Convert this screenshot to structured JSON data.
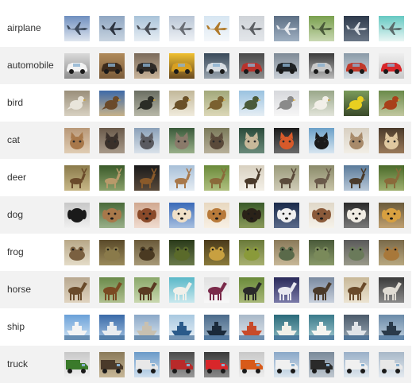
{
  "classes": [
    {
      "label": "airplane",
      "thumbs": [
        {
          "bg": [
            "#6f8fbf",
            "#dfe6ef"
          ],
          "subject": "#3d4a5c",
          "icon": "plane-icon"
        },
        {
          "bg": [
            "#8fa6c2",
            "#c8d4e0"
          ],
          "subject": "#2d3440",
          "icon": "plane-icon"
        },
        {
          "bg": [
            "#a9c3d9",
            "#e8eef4"
          ],
          "subject": "#4a4f57",
          "icon": "plane-icon"
        },
        {
          "bg": [
            "#b9c6d6",
            "#eef1f5"
          ],
          "subject": "#6a6e75",
          "icon": "plane-icon"
        },
        {
          "bg": [
            "#d7e6f2",
            "#f4f7fa"
          ],
          "subject": "#b07a2a",
          "icon": "plane-icon"
        },
        {
          "bg": [
            "#cfd3d8",
            "#e3e6ea"
          ],
          "subject": "#5c5f63",
          "icon": "plane-icon"
        },
        {
          "bg": [
            "#5d6f84",
            "#9fb0c2"
          ],
          "subject": "#e6e9ee",
          "icon": "plane-icon"
        },
        {
          "bg": [
            "#7aa04f",
            "#c9d8b2"
          ],
          "subject": "#4a5a3a",
          "icon": "plane-icon"
        },
        {
          "bg": [
            "#2e3a4c",
            "#6a7686"
          ],
          "subject": "#d9dde3",
          "icon": "plane-icon"
        },
        {
          "bg": [
            "#66c9c2",
            "#e8f6f4"
          ],
          "subject": "#5a6a6a",
          "icon": "plane-icon"
        }
      ]
    },
    {
      "label": "automobile",
      "thumbs": [
        {
          "bg": [
            "#dadada",
            "#8d8d8d"
          ],
          "subject": "#f2f2f2",
          "icon": "car-icon"
        },
        {
          "bg": [
            "#b08a5b",
            "#7b5c3a"
          ],
          "subject": "#3c2a1b",
          "icon": "car-icon"
        },
        {
          "bg": [
            "#7a6a5a",
            "#c9b49a"
          ],
          "subject": "#2f2b28",
          "icon": "car-icon"
        },
        {
          "bg": [
            "#f0c030",
            "#6a4a20"
          ],
          "subject": "#d8a020",
          "icon": "car-icon"
        },
        {
          "bg": [
            "#3a4a5a",
            "#9aa4ae"
          ],
          "subject": "#d7dde3",
          "icon": "car-icon"
        },
        {
          "bg": [
            "#4a4a4a",
            "#8e8e8e"
          ],
          "subject": "#b8322c",
          "icon": "car-icon"
        },
        {
          "bg": [
            "#7e8a96",
            "#c9cfd6"
          ],
          "subject": "#1f2326",
          "icon": "car-icon"
        },
        {
          "bg": [
            "#3b3b3b",
            "#b9b9b9"
          ],
          "subject": "#c8c8c8",
          "icon": "car-icon"
        },
        {
          "bg": [
            "#8a9aa8",
            "#d6dde3"
          ],
          "subject": "#c0392b",
          "icon": "car-icon"
        },
        {
          "bg": [
            "#eeeeee",
            "#c9c9c9"
          ],
          "subject": "#d8262a",
          "icon": "car-icon"
        }
      ]
    },
    {
      "label": "bird",
      "thumbs": [
        {
          "bg": [
            "#9a8f7a",
            "#d8d1c2"
          ],
          "subject": "#e9e5db",
          "icon": "bird-icon"
        },
        {
          "bg": [
            "#3d6aa8",
            "#c7b28a"
          ],
          "subject": "#6a4a2a",
          "icon": "bird-icon"
        },
        {
          "bg": [
            "#6a6e62",
            "#b8b8a8"
          ],
          "subject": "#2a2c26",
          "icon": "bird-icon"
        },
        {
          "bg": [
            "#c2b89a",
            "#f0ebdc"
          ],
          "subject": "#6a5028",
          "icon": "bird-icon"
        },
        {
          "bg": [
            "#a2a87a",
            "#dcd8b8"
          ],
          "subject": "#7a6030",
          "icon": "bird-icon"
        },
        {
          "bg": [
            "#9ac2e0",
            "#e6eef4"
          ],
          "subject": "#4a5a3a",
          "icon": "bird-icon"
        },
        {
          "bg": [
            "#d6d8dc",
            "#f6f6f6"
          ],
          "subject": "#8a8a8a",
          "icon": "bird-icon"
        },
        {
          "bg": [
            "#9aa88a",
            "#e2e4da"
          ],
          "subject": "#f2efe8",
          "icon": "bird-icon"
        },
        {
          "bg": [
            "#7a9a5a",
            "#3a4a2a"
          ],
          "subject": "#e8d020",
          "icon": "bird-icon"
        },
        {
          "bg": [
            "#6a8a4a",
            "#c2c8a0"
          ],
          "subject": "#a8401a",
          "icon": "bird-icon"
        }
      ]
    },
    {
      "label": "cat",
      "thumbs": [
        {
          "bg": [
            "#b89878",
            "#e0cdb4"
          ],
          "subject": "#a8784a",
          "icon": "cat-icon"
        },
        {
          "bg": [
            "#6a5a4a",
            "#a89a8a"
          ],
          "subject": "#3a302a",
          "icon": "cat-icon"
        },
        {
          "bg": [
            "#8aa0b8",
            "#dae2ea"
          ],
          "subject": "#5a5a60",
          "icon": "cat-icon"
        },
        {
          "bg": [
            "#3a5a3a",
            "#9ab08a"
          ],
          "subject": "#8a7a6a",
          "icon": "cat-icon"
        },
        {
          "bg": [
            "#7a7a5a",
            "#b8b09a"
          ],
          "subject": "#5a4a3a",
          "icon": "cat-icon"
        },
        {
          "bg": [
            "#2a4a3a",
            "#6a8a7a"
          ],
          "subject": "#c8b89a",
          "icon": "cat-icon"
        },
        {
          "bg": [
            "#1a1a1a",
            "#6a6a6a"
          ],
          "subject": "#d85a2a",
          "icon": "cat-icon"
        },
        {
          "bg": [
            "#6aa0c8",
            "#d8e6f0"
          ],
          "subject": "#1a1a1a",
          "icon": "cat-icon"
        },
        {
          "bg": [
            "#d8d0c2",
            "#f2eee6"
          ],
          "subject": "#a88a6a",
          "icon": "cat-icon"
        },
        {
          "bg": [
            "#4a3a2a",
            "#9a7a5a"
          ],
          "subject": "#e0c8a0",
          "icon": "cat-icon"
        }
      ]
    },
    {
      "label": "deer",
      "thumbs": [
        {
          "bg": [
            "#8a7a4a",
            "#c8b888"
          ],
          "subject": "#6a4a2a",
          "icon": "deer-icon"
        },
        {
          "bg": [
            "#3a5a2a",
            "#8aa06a"
          ],
          "subject": "#b89a6a",
          "icon": "deer-icon"
        },
        {
          "bg": [
            "#1a1a1a",
            "#5a4a3a"
          ],
          "subject": "#8a5a2a",
          "icon": "deer-icon"
        },
        {
          "bg": [
            "#a8c0d8",
            "#e6edf3"
          ],
          "subject": "#a8784a",
          "icon": "deer-icon"
        },
        {
          "bg": [
            "#6a8a3a",
            "#b0c080"
          ],
          "subject": "#8a6a3a",
          "icon": "deer-icon"
        },
        {
          "bg": [
            "#d8d0c0",
            "#f4f0e8"
          ],
          "subject": "#4a3a2a",
          "icon": "deer-icon"
        },
        {
          "bg": [
            "#9a9a7a",
            "#d0ccb8"
          ],
          "subject": "#5a4a3a",
          "icon": "deer-icon"
        },
        {
          "bg": [
            "#8a8a6a",
            "#c8c4a8"
          ],
          "subject": "#6a5a4a",
          "icon": "deer-icon"
        },
        {
          "bg": [
            "#5a7a9a",
            "#b8c8d8"
          ],
          "subject": "#4a3a2a",
          "icon": "deer-icon"
        },
        {
          "bg": [
            "#4a6a2a",
            "#a0b070"
          ],
          "subject": "#8a6a3a",
          "icon": "deer-icon"
        }
      ]
    },
    {
      "label": "dog",
      "thumbs": [
        {
          "bg": [
            "#c8c8c8",
            "#f0f0f0"
          ],
          "subject": "#1a1a1a",
          "icon": "dog-icon"
        },
        {
          "bg": [
            "#4a6a3a",
            "#9ab08a"
          ],
          "subject": "#a8784a",
          "icon": "dog-icon"
        },
        {
          "bg": [
            "#d0a890",
            "#f0dcd0"
          ],
          "subject": "#8a4a2a",
          "icon": "dog-icon"
        },
        {
          "bg": [
            "#3a6ab8",
            "#a8c0e0"
          ],
          "subject": "#f0e0c8",
          "icon": "dog-icon"
        },
        {
          "bg": [
            "#e8d8c0",
            "#f8f0e4"
          ],
          "subject": "#b87a3a",
          "icon": "dog-icon"
        },
        {
          "bg": [
            "#3a5a2a",
            "#8a9a5a"
          ],
          "subject": "#2a2218",
          "icon": "dog-icon"
        },
        {
          "bg": [
            "#1a2a4a",
            "#5a6a8a"
          ],
          "subject": "#f0f0f0",
          "icon": "dog-icon"
        },
        {
          "bg": [
            "#e0d8c8",
            "#f6f2ea"
          ],
          "subject": "#8a5a3a",
          "icon": "dog-icon"
        },
        {
          "bg": [
            "#2a2a2a",
            "#7a7a7a"
          ],
          "subject": "#f0ece4",
          "icon": "dog-icon"
        },
        {
          "bg": [
            "#6a5a3a",
            "#c0a070"
          ],
          "subject": "#d8a040",
          "icon": "dog-icon"
        }
      ]
    },
    {
      "label": "frog",
      "thumbs": [
        {
          "bg": [
            "#b8a888",
            "#e4dcc8"
          ],
          "subject": "#7a6040",
          "icon": "frog-icon"
        },
        {
          "bg": [
            "#5a4a2a",
            "#9a8a5a"
          ],
          "subject": "#8a7a4a",
          "icon": "frog-icon"
        },
        {
          "bg": [
            "#6a5a3a",
            "#a89a78"
          ],
          "subject": "#4a3a22",
          "icon": "frog-icon"
        },
        {
          "bg": [
            "#2a3a1a",
            "#6a7a4a"
          ],
          "subject": "#5a6a2a",
          "icon": "frog-icon"
        },
        {
          "bg": [
            "#4a3a1a",
            "#8a7a3a"
          ],
          "subject": "#c8a040",
          "icon": "frog-icon"
        },
        {
          "bg": [
            "#6a7a3a",
            "#a8b070"
          ],
          "subject": "#8a9a3a",
          "icon": "frog-icon"
        },
        {
          "bg": [
            "#8a7a5a",
            "#c8b898"
          ],
          "subject": "#5a6a4a",
          "icon": "frog-icon"
        },
        {
          "bg": [
            "#4a5a3a",
            "#8a9a6a"
          ],
          "subject": "#7a8a5a",
          "icon": "frog-icon"
        },
        {
          "bg": [
            "#5a5a5a",
            "#9a9a8a"
          ],
          "subject": "#6a7a5a",
          "icon": "frog-icon"
        },
        {
          "bg": [
            "#7a6a4a",
            "#b8a880"
          ],
          "subject": "#a8783a",
          "icon": "frog-icon"
        }
      ]
    },
    {
      "label": "horse",
      "thumbs": [
        {
          "bg": [
            "#b8a890",
            "#e0d4c0"
          ],
          "subject": "#6a4a2a",
          "icon": "horse-icon"
        },
        {
          "bg": [
            "#6a8a4a",
            "#b0c090"
          ],
          "subject": "#7a4a22",
          "icon": "horse-icon"
        },
        {
          "bg": [
            "#8aa86a",
            "#cad8b0"
          ],
          "subject": "#5a3a22",
          "icon": "horse-icon"
        },
        {
          "bg": [
            "#5ab8c8",
            "#c8e8ee"
          ],
          "subject": "#f0f0ea",
          "icon": "horse-icon"
        },
        {
          "bg": [
            "#e0e0e0",
            "#f8f8f8"
          ],
          "subject": "#7a2a4a",
          "icon": "horse-icon"
        },
        {
          "bg": [
            "#6a8a3a",
            "#a8b878"
          ],
          "subject": "#2a2a2a",
          "icon": "horse-icon"
        },
        {
          "bg": [
            "#2a2a5a",
            "#7a7aa8"
          ],
          "subject": "#e8e8f0",
          "icon": "horse-icon"
        },
        {
          "bg": [
            "#7a8aa0",
            "#c8d0dc"
          ],
          "subject": "#4a3a2a",
          "icon": "horse-icon"
        },
        {
          "bg": [
            "#c8b898",
            "#ece4d2"
          ],
          "subject": "#6a4a2a",
          "icon": "horse-icon"
        },
        {
          "bg": [
            "#3a3a3a",
            "#8a8a8a"
          ],
          "subject": "#e0dcd4",
          "icon": "horse-icon"
        }
      ]
    },
    {
      "label": "ship",
      "thumbs": [
        {
          "bg": [
            "#6aa0d8",
            "#d0e4f4"
          ],
          "subject": "#f4f4f4",
          "icon": "ship-icon"
        },
        {
          "bg": [
            "#3a6aa8",
            "#a0c0e0"
          ],
          "subject": "#e8ecf0",
          "icon": "ship-icon"
        },
        {
          "bg": [
            "#8aa8c8",
            "#dce6ee"
          ],
          "subject": "#c8c0b0",
          "icon": "ship-icon"
        },
        {
          "bg": [
            "#a8c8e0",
            "#e8f0f6"
          ],
          "subject": "#2a5a8a",
          "icon": "ship-icon"
        },
        {
          "bg": [
            "#4a6a8a",
            "#9ab0c4"
          ],
          "subject": "#1a2a3a",
          "icon": "ship-icon"
        },
        {
          "bg": [
            "#a8b8c8",
            "#e0e6ec"
          ],
          "subject": "#c84a2a",
          "icon": "ship-icon"
        },
        {
          "bg": [
            "#2a6a7a",
            "#8ab8c0"
          ],
          "subject": "#f0f0e8",
          "icon": "ship-icon"
        },
        {
          "bg": [
            "#3a7a8a",
            "#a0c8d0"
          ],
          "subject": "#f4f4f0",
          "icon": "ship-icon"
        },
        {
          "bg": [
            "#4a5a6a",
            "#9aa8b4"
          ],
          "subject": "#e0e4e8",
          "icon": "ship-icon"
        },
        {
          "bg": [
            "#6a8aa8",
            "#c0d0de"
          ],
          "subject": "#2a3a4a",
          "icon": "ship-icon"
        }
      ]
    },
    {
      "label": "truck",
      "thumbs": [
        {
          "bg": [
            "#c8c8c8",
            "#f0f0f0"
          ],
          "subject": "#3a7a2a",
          "icon": "truck-icon"
        },
        {
          "bg": [
            "#8a7a5a",
            "#c8b898"
          ],
          "subject": "#4a3a2a",
          "icon": "truck-icon"
        },
        {
          "bg": [
            "#6a9ac8",
            "#d0e0ee"
          ],
          "subject": "#e8e8e8",
          "icon": "truck-icon"
        },
        {
          "bg": [
            "#4a4a4a",
            "#9a9a9a"
          ],
          "subject": "#b82a2a",
          "icon": "truck-icon"
        },
        {
          "bg": [
            "#3a3a3a",
            "#8a8a8a"
          ],
          "subject": "#d8262a",
          "icon": "truck-icon"
        },
        {
          "bg": [
            "#c8c8c8",
            "#eeeeee"
          ],
          "subject": "#d85a1a",
          "icon": "truck-icon"
        },
        {
          "bg": [
            "#8aa8c8",
            "#dce6ee"
          ],
          "subject": "#f0f0f0",
          "icon": "truck-icon"
        },
        {
          "bg": [
            "#7a8a9a",
            "#c0c8d0"
          ],
          "subject": "#2a2a2a",
          "icon": "truck-icon"
        },
        {
          "bg": [
            "#9ab0c8",
            "#e0e8ee"
          ],
          "subject": "#f0f0f0",
          "icon": "truck-icon"
        },
        {
          "bg": [
            "#a8b8c8",
            "#e4eaf0"
          ],
          "subject": "#e8e8e8",
          "icon": "truck-icon"
        }
      ]
    }
  ]
}
